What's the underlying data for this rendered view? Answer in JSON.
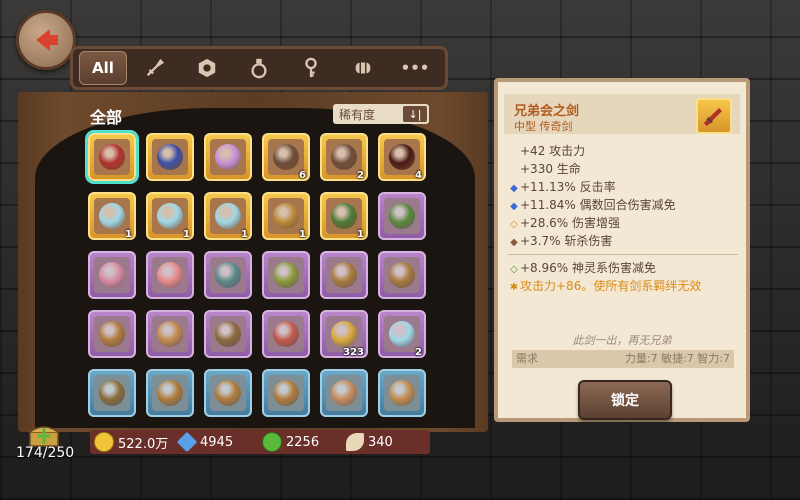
{
  "tabs": [
    {
      "label": "All",
      "icon": "all-text"
    },
    {
      "label": "",
      "icon": "sword-icon"
    },
    {
      "label": "",
      "icon": "shield-hex-icon"
    },
    {
      "label": "",
      "icon": "potion-icon"
    },
    {
      "label": "",
      "icon": "key-icon"
    },
    {
      "label": "",
      "icon": "scroll-icon"
    },
    {
      "label": "•••",
      "icon": "more-icon"
    }
  ],
  "list": {
    "title": "全部",
    "sort_label": "稀有度",
    "sort_icon": "↓|"
  },
  "grid": [
    {
      "rarity": "gold",
      "item": "sword",
      "color": "#b33030",
      "count": "",
      "selected": true
    },
    {
      "rarity": "gold",
      "item": "bracer",
      "color": "#3b4fa8",
      "count": ""
    },
    {
      "rarity": "gold",
      "item": "gem-orb",
      "color": "#c790d8",
      "count": ""
    },
    {
      "rarity": "gold",
      "item": "puzzle-piece",
      "color": "#6e4e3a",
      "count": "6"
    },
    {
      "rarity": "gold",
      "item": "puzzle-piece-knife",
      "color": "#6e4e3a",
      "count": "2"
    },
    {
      "rarity": "gold",
      "item": "dark-orb",
      "color": "#4a1a12",
      "count": "4"
    },
    {
      "rarity": "gold",
      "item": "ticket",
      "color": "#9fd8e6",
      "count": "1"
    },
    {
      "rarity": "gold",
      "item": "ticket",
      "color": "#9fd8e6",
      "count": "1"
    },
    {
      "rarity": "gold",
      "item": "ticket",
      "color": "#9fd8e6",
      "count": "1"
    },
    {
      "rarity": "gold",
      "item": "puzzle-piece-gold",
      "color": "#b98a3a",
      "count": "1"
    },
    {
      "rarity": "gold",
      "item": "puzzle-piece-green",
      "color": "#4e7a3a",
      "count": "1"
    },
    {
      "rarity": "purple",
      "item": "crossbow",
      "color": "#5a8a3a",
      "count": ""
    },
    {
      "rarity": "purple",
      "item": "flower-staff",
      "color": "#d88aa0",
      "count": ""
    },
    {
      "rarity": "purple",
      "item": "flower-ring",
      "color": "#e88a8a",
      "count": ""
    },
    {
      "rarity": "purple",
      "item": "helmet",
      "color": "#5a8a8a",
      "count": ""
    },
    {
      "rarity": "purple",
      "item": "curved-blade",
      "color": "#8a9a3a",
      "count": ""
    },
    {
      "rarity": "purple",
      "item": "acorn-staff",
      "color": "#a87a3a",
      "count": ""
    },
    {
      "rarity": "purple",
      "item": "acorn-staff",
      "color": "#a87a3a",
      "count": ""
    },
    {
      "rarity": "purple",
      "item": "scimitar",
      "color": "#b07a3a",
      "count": ""
    },
    {
      "rarity": "purple",
      "item": "lute",
      "color": "#c08a4a",
      "count": ""
    },
    {
      "rarity": "purple",
      "item": "acorn",
      "color": "#8a6a3a",
      "count": ""
    },
    {
      "rarity": "purple",
      "item": "rose-staff",
      "color": "#c05a4a",
      "count": ""
    },
    {
      "rarity": "purple",
      "item": "wheat",
      "color": "#d8a83a",
      "count": "323"
    },
    {
      "rarity": "purple",
      "item": "ticket",
      "color": "#9fd8e6",
      "count": "2"
    },
    {
      "rarity": "blue",
      "item": "acorn",
      "color": "#8a6a3a",
      "count": ""
    },
    {
      "rarity": "blue",
      "item": "scimitar",
      "color": "#b07a3a",
      "count": ""
    },
    {
      "rarity": "blue",
      "item": "scimitar",
      "color": "#b07a3a",
      "count": ""
    },
    {
      "rarity": "blue",
      "item": "scimitar",
      "color": "#b07a3a",
      "count": ""
    },
    {
      "rarity": "blue",
      "item": "mushroom-fist",
      "color": "#c88a5a",
      "count": ""
    },
    {
      "rarity": "blue",
      "item": "lute",
      "color": "#c08a4a",
      "count": ""
    }
  ],
  "inventory": {
    "capacity": "174/250"
  },
  "currency": [
    {
      "icon": "gold-coin-icon",
      "color": "#f2c43a",
      "value": "522.0万"
    },
    {
      "icon": "diamond-icon",
      "color": "#5aa0e8",
      "value": "4945"
    },
    {
      "icon": "green-orb-icon",
      "color": "#5ab83a",
      "value": "2256"
    },
    {
      "icon": "feather-icon",
      "color": "#e8d8b8",
      "value": "340"
    }
  ],
  "detail": {
    "name": "兄弟会之剑",
    "type": "中型 传奇剑",
    "stats_basic": [
      "+42 攻击力",
      "+330 生命"
    ],
    "stats_bonus": [
      {
        "mark": "◆",
        "color": "#3a6ad8",
        "text": "+11.13% 反击率"
      },
      {
        "mark": "◆",
        "color": "#3a6ad8",
        "text": "+11.84% 偶数回合伤害减免"
      },
      {
        "mark": "◇",
        "color": "#d98b18",
        "text": "+28.6% 伤害增强"
      },
      {
        "mark": "◆",
        "color": "#8a5a3a",
        "text": "+3.7% 斩杀伤害"
      }
    ],
    "stats_set": [
      {
        "mark": "◇",
        "color": "#4a9a3a",
        "text": "+8.96% 神灵系伤害减免",
        "special": false
      },
      {
        "mark": "✱",
        "color": "#d98b18",
        "text": "攻击力+86。使所有剑系羁绊无效",
        "special": true
      }
    ],
    "flavor": "此剑一出，再无兄弟",
    "requirement_label": "需求",
    "requirement_values": "力量:7 敏捷:7 智力:7",
    "lock_label": "锁定"
  }
}
